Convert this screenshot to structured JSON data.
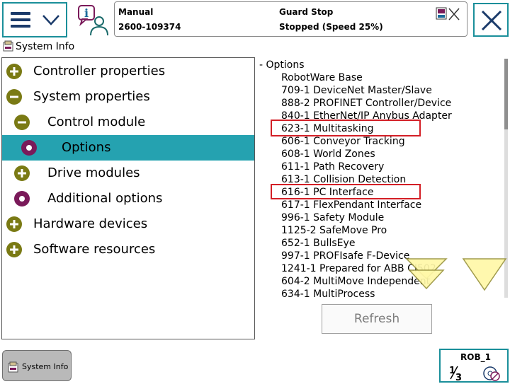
{
  "header": {
    "menu_icon": "hamburger-menu-icon",
    "info_icon": "info-person-icon",
    "mode": "Manual",
    "system_id": "2600-109374",
    "safety_state": "Guard Stop",
    "run_state": "Stopped (Speed 25%)",
    "status_icons": "program-disabled-icon",
    "close_icon": "close-icon"
  },
  "window": {
    "title": "System Info",
    "icon": "system-info-icon"
  },
  "tree": [
    {
      "label": "Controller properties",
      "icon": "expand-plus-icon"
    },
    {
      "label": "System properties",
      "icon": "collapse-minus-icon"
    },
    {
      "label": "Control module",
      "icon": "collapse-minus-icon"
    },
    {
      "label": "Options",
      "icon": "leaf-dot-icon",
      "selected": true
    },
    {
      "label": "Drive modules",
      "icon": "expand-plus-icon"
    },
    {
      "label": "Additional options",
      "icon": "leaf-dot-icon"
    },
    {
      "label": "Hardware devices",
      "icon": "expand-plus-icon"
    },
    {
      "label": "Software resources",
      "icon": "expand-plus-icon"
    }
  ],
  "options": {
    "header": "- Options",
    "items": [
      "RobotWare Base",
      "709-1 DeviceNet Master/Slave",
      "888-2 PROFINET Controller/Device",
      "840-1 EtherNet/IP Anybus Adapter",
      "623-1 Multitasking",
      "606-1 Conveyor Tracking",
      "608-1 World Zones",
      "611-1 Path Recovery",
      "613-1 Collision Detection",
      "616-1 PC Interface",
      "617-1 FlexPendant Interface",
      "996-1 Safety Module",
      "1125-2 SafeMove Pro",
      "652-1 BullsEye",
      "997-1 PROFIsafe F-Device",
      "1241-1 Prepared for ABB CI502",
      "604-2 MultiMove Independent",
      "634-1 MultiProcess"
    ],
    "refresh_label": "Refresh",
    "scroll_down_icon": "scroll-down-arrow-icon",
    "page_down_icon": "page-down-arrow-icon"
  },
  "bottom": {
    "task_label": "System Info",
    "rob_label": "ROB_1",
    "jog_icon": "jog-increment-icon"
  },
  "colors": {
    "accent": "#1a8f9a",
    "selected_row": "#25a2b0",
    "plus_icon": "#7a7a14",
    "leaf_icon": "#7a1a5a",
    "highlight": "#d31f26"
  }
}
